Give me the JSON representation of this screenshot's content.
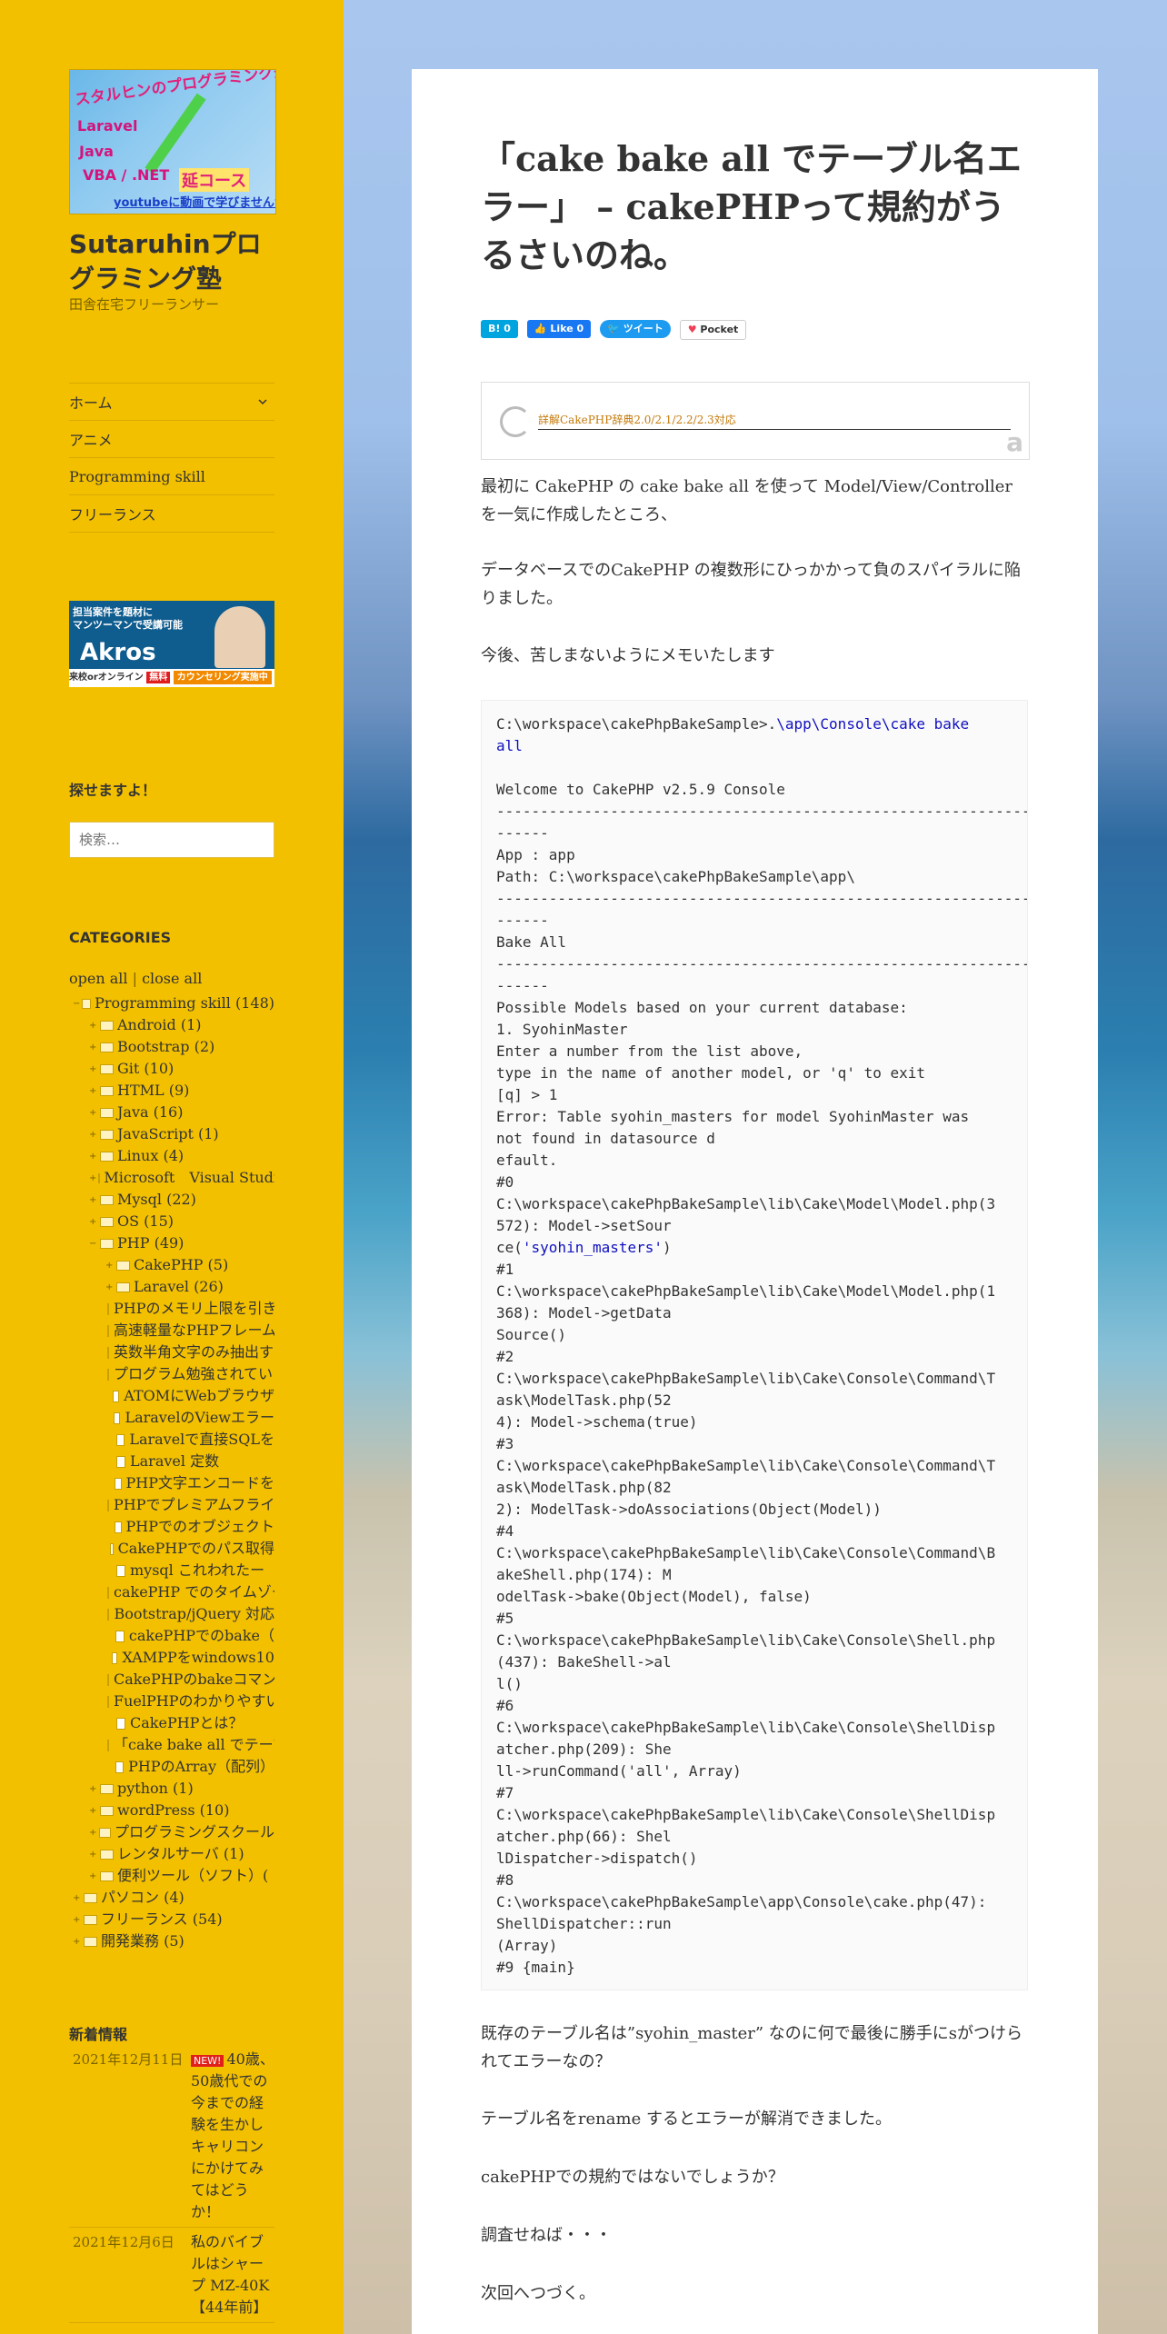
{
  "logo": {
    "title": "スタルヒンのプログラミング塾",
    "lines": [
      "Laravel",
      "Java",
      "VBA / .NET",
      "延コース"
    ],
    "footer": "youtubeに動画で学びませんか?"
  },
  "site": {
    "title": "Sutaruhinプログラミング塾",
    "description": "田舎在宅フリーランサー"
  },
  "nav": {
    "items": [
      {
        "label": "ホーム",
        "icon": "chevron-down-icon"
      },
      {
        "label": "アニメ"
      },
      {
        "label": "Programming skill"
      },
      {
        "label": "フリーランス"
      }
    ]
  },
  "ad": {
    "line1": "担当案件を題材に",
    "line2": "マンツーマンで受講可能",
    "brand": "Akros",
    "footer": "来校orオンライン",
    "free": "無料",
    "counsel": "カウンセリング実施中"
  },
  "search": {
    "title": "探せますよ！",
    "placeholder": "検索…"
  },
  "categories": {
    "title": "CATEGORIES",
    "open_all": "open all",
    "sep": " | ",
    "close_all": "close all",
    "items": [
      {
        "label": "Programming skill (148)",
        "level": 0,
        "type": "folder",
        "toggle": "−"
      },
      {
        "label": "Android (1)",
        "level": 1,
        "type": "folder",
        "toggle": "+"
      },
      {
        "label": "Bootstrap (2)",
        "level": 1,
        "type": "folder",
        "toggle": "+"
      },
      {
        "label": "Git (10)",
        "level": 1,
        "type": "folder",
        "toggle": "+"
      },
      {
        "label": "HTML (9)",
        "level": 1,
        "type": "folder",
        "toggle": "+"
      },
      {
        "label": "Java (16)",
        "level": 1,
        "type": "folder",
        "toggle": "+"
      },
      {
        "label": "JavaScript (1)",
        "level": 1,
        "type": "folder",
        "toggle": "+"
      },
      {
        "label": "Linux (4)",
        "level": 1,
        "type": "folder",
        "toggle": "+"
      },
      {
        "label": "Microsoft　Visual Studio",
        "level": 1,
        "type": "folder",
        "toggle": "+"
      },
      {
        "label": "Mysql (22)",
        "level": 1,
        "type": "folder",
        "toggle": "+"
      },
      {
        "label": "OS (15)",
        "level": 1,
        "type": "folder",
        "toggle": "+"
      },
      {
        "label": "PHP (49)",
        "level": 1,
        "type": "folder",
        "toggle": "−"
      },
      {
        "label": "CakePHP (5)",
        "level": 2,
        "type": "folder",
        "toggle": "+"
      },
      {
        "label": "Laravel (26)",
        "level": 2,
        "type": "folder",
        "toggle": "+"
      },
      {
        "label": "PHPのメモリ上限を引き上げる",
        "level": 2,
        "type": "doc"
      },
      {
        "label": "高速軽量なPHPフレームワーク",
        "level": 2,
        "type": "doc"
      },
      {
        "label": "英数半角文字のみ抽出する",
        "level": 2,
        "type": "doc"
      },
      {
        "label": "プログラム勉強されている方へ",
        "level": 2,
        "type": "doc"
      },
      {
        "label": "ATOMにWebブラウザ",
        "level": 2,
        "type": "doc"
      },
      {
        "label": "LaravelのViewエラー",
        "level": 2,
        "type": "doc"
      },
      {
        "label": "Laravelで直接SQLを",
        "level": 2,
        "type": "doc"
      },
      {
        "label": "Laravel 定数",
        "level": 2,
        "type": "doc"
      },
      {
        "label": "PHP文字エンコードを",
        "level": 2,
        "type": "doc"
      },
      {
        "label": "PHPでプレミアムフライデー",
        "level": 2,
        "type": "doc"
      },
      {
        "label": "PHPでのオブジェクト",
        "level": 2,
        "type": "doc"
      },
      {
        "label": "CakePHPでのパス取得",
        "level": 2,
        "type": "doc"
      },
      {
        "label": "mysql これわれたー",
        "level": 2,
        "type": "doc"
      },
      {
        "label": "cakePHP でのタイムゾーン",
        "level": 2,
        "type": "doc"
      },
      {
        "label": "Bootstrap/jQuery 対応",
        "level": 2,
        "type": "doc"
      },
      {
        "label": "cakePHPでのbake（",
        "level": 2,
        "type": "doc"
      },
      {
        "label": "XAMPPをwindows10",
        "level": 2,
        "type": "doc"
      },
      {
        "label": "CakePHPのbakeコマンド",
        "level": 2,
        "type": "doc"
      },
      {
        "label": "FuelPHPのわかりやすい",
        "level": 2,
        "type": "doc"
      },
      {
        "label": "CakePHPとは？",
        "level": 2,
        "type": "doc"
      },
      {
        "label": "「cake bake all でテーブル名エラー」",
        "level": 2,
        "type": "doc"
      },
      {
        "label": "PHPのArray（配列）",
        "level": 2,
        "type": "doc"
      },
      {
        "label": "python (1)",
        "level": 1,
        "type": "folder",
        "toggle": "+"
      },
      {
        "label": "wordPress (10)",
        "level": 1,
        "type": "folder",
        "toggle": "+"
      },
      {
        "label": "プログラミングスクール",
        "level": 1,
        "type": "folder",
        "toggle": "+"
      },
      {
        "label": "レンタルサーバ (1)",
        "level": 1,
        "type": "folder",
        "toggle": "+"
      },
      {
        "label": "便利ツール（ソフト）(",
        "level": 1,
        "type": "folder",
        "toggle": "+"
      },
      {
        "label": "パソコン (4)",
        "level": 0,
        "type": "folder",
        "toggle": "+"
      },
      {
        "label": "フリーランス (54)",
        "level": 0,
        "type": "folder",
        "toggle": "+"
      },
      {
        "label": "開発業務 (5)",
        "level": 0,
        "type": "folder",
        "toggle": "+"
      }
    ]
  },
  "news": {
    "title": "新着情報",
    "items": [
      {
        "date": "2021年12月11日",
        "badge": "NEW!",
        "text": "40歳、50歳代での今までの経験を生かしキャリコンにかけてみてはどうか！"
      },
      {
        "date": "2021年12月6日",
        "badge": "",
        "text": "私のバイブルはシャープ MZ-40K【44年前】"
      }
    ]
  },
  "article": {
    "title": "「cake bake all でテーブル名エラー」 – cakePHPって規約がうるさいのね。",
    "share": {
      "hatena": "B! 0",
      "facebook": "Like 0",
      "twitter": "ツイート",
      "pocket": "Pocket"
    },
    "linkcard": {
      "title": "詳解CakePHP辞典2.0/2.1/2.2/2.3対応",
      "mark": "a"
    },
    "intro": [
      "最初に CakePHP の cake bake all を使って Model/View/Controller を一気に作成したところ、",
      "データベースでのCakePHP の複数形にひっかかって負のスパイラルに陥りました。",
      "今後、苦しまないようにメモいたします"
    ],
    "code": {
      "prompt": "C:\\workspace\\cakePhpBakeSample>.",
      "cmd": "\\app\\Console\\cake bake\nall",
      "body1": "\n\nWelcome to CakePHP v2.5.9 Console\n---------------------------------------------------------------\n------\nApp : app\nPath: C:\\workspace\\cakePhpBakeSample\\app\\\n---------------------------------------------------------------\n------\nBake All\n---------------------------------------------------------------\n------\nPossible Models based on your current database:\n1. SyohinMaster\nEnter a number from the list above,\ntype in the name of another model, or 'q' to exit\n[q] > 1\nError: Table syohin_masters for model SyohinMaster was\nnot found in datasource d\nefault.\n#0\nC:\\workspace\\cakePhpBakeSample\\lib\\Cake\\Model\\Model.php(3\n572): Model->setSour\nce(",
      "str": "'syohin_masters'",
      "body2": ")\n#1\nC:\\workspace\\cakePhpBakeSample\\lib\\Cake\\Model\\Model.php(1\n368): Model->getData\nSource()\n#2\nC:\\workspace\\cakePhpBakeSample\\lib\\Cake\\Console\\Command\\T\nask\\ModelTask.php(52\n4): Model->schema(true)\n#3\nC:\\workspace\\cakePhpBakeSample\\lib\\Cake\\Console\\Command\\T\nask\\ModelTask.php(82\n2): ModelTask->doAssociations(Object(Model))\n#4\nC:\\workspace\\cakePhpBakeSample\\lib\\Cake\\Console\\Command\\B\nakeShell.php(174): M\nodelTask->bake(Object(Model), false)\n#5\nC:\\workspace\\cakePhpBakeSample\\lib\\Cake\\Console\\Shell.php\n(437): BakeShell->al\nl()\n#6\nC:\\workspace\\cakePhpBakeSample\\lib\\Cake\\Console\\ShellDisp\natcher.php(209): She\nll->runCommand('all', Array)\n#7\nC:\\workspace\\cakePhpBakeSample\\lib\\Cake\\Console\\ShellDisp\natcher.php(66): Shel\nlDispatcher->dispatch()\n#8\nC:\\workspace\\cakePhpBakeSample\\app\\Console\\cake.php(47):\nShellDispatcher::run\n(Array)\n#9 {main}"
    },
    "outro": [
      "既存のテーブル名は”syohin_master” なのに何で最後に勝手にsがつけられてエラーなの？",
      "テーブル名をrename するとエラーが解消できました。",
      "cakePHPでの規約ではないでしょうか？",
      "調査せねば・・・",
      "次回へつづく。"
    ]
  }
}
